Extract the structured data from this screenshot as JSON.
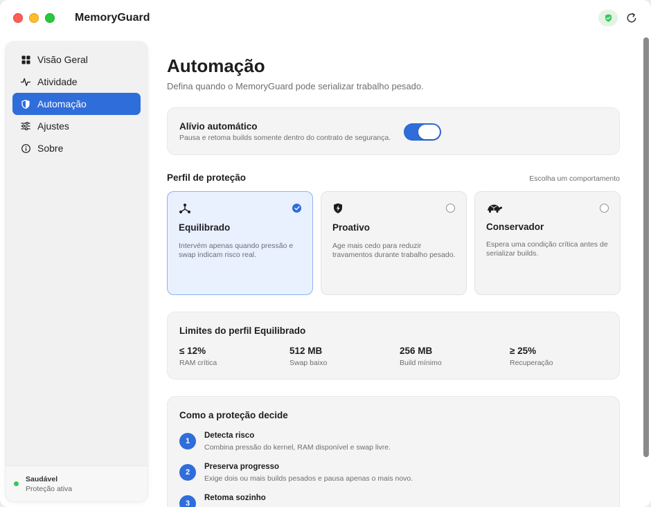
{
  "app": {
    "title": "MemoryGuard"
  },
  "titlebar": {
    "status_icon": "shield-check-icon",
    "refresh_icon": "refresh-icon"
  },
  "sidebar": {
    "items": [
      {
        "label": "Visão Geral",
        "icon": "grid-icon",
        "active": false
      },
      {
        "label": "Atividade",
        "icon": "activity-icon",
        "active": false
      },
      {
        "label": "Automação",
        "icon": "shield-icon",
        "active": true
      },
      {
        "label": "Ajustes",
        "icon": "sliders-icon",
        "active": false
      },
      {
        "label": "Sobre",
        "icon": "info-icon",
        "active": false
      }
    ],
    "status": {
      "title": "Saudável",
      "subtitle": "Proteção ativa",
      "color": "#34c759"
    }
  },
  "main": {
    "title": "Automação",
    "subtitle": "Defina quando o MemoryGuard pode serializar trabalho pesado.",
    "auto_relief": {
      "title": "Alívio automático",
      "description": "Pausa e retoma builds somente dentro do contrato de segurança.",
      "enabled": true
    },
    "profile": {
      "title": "Perfil de proteção",
      "hint": "Escolha um comportamento",
      "options": [
        {
          "name": "Equilibrado",
          "description": "Intervém apenas quando pressão e swap indicam risco real.",
          "icon": "nodes-icon",
          "selected": true
        },
        {
          "name": "Proativo",
          "description": "Age mais cedo para reduzir travamentos durante trabalho pesado.",
          "icon": "shield-bolt-icon",
          "selected": false
        },
        {
          "name": "Conservador",
          "description": "Espera uma condição crítica antes de serializar builds.",
          "icon": "turtle-icon",
          "selected": false
        }
      ]
    },
    "limits": {
      "title": "Limites do perfil Equilibrado",
      "items": [
        {
          "value": "≤ 12%",
          "label": "RAM crítica"
        },
        {
          "value": "512 MB",
          "label": "Swap baixo"
        },
        {
          "value": "256 MB",
          "label": "Build mínimo"
        },
        {
          "value": "≥ 25%",
          "label": "Recuperação"
        }
      ]
    },
    "how": {
      "title": "Como a proteção decide",
      "steps": [
        {
          "num": "1",
          "title": "Detecta risco",
          "description": "Combina pressão do kernel, RAM disponível e swap livre."
        },
        {
          "num": "2",
          "title": "Preserva progresso",
          "description": "Exige dois ou mais builds pesados e pausa apenas o mais novo."
        },
        {
          "num": "3",
          "title": "Retoma sozinho",
          "description": ""
        }
      ]
    }
  },
  "colors": {
    "accent": "#2f6ddb",
    "ok": "#34c759"
  }
}
